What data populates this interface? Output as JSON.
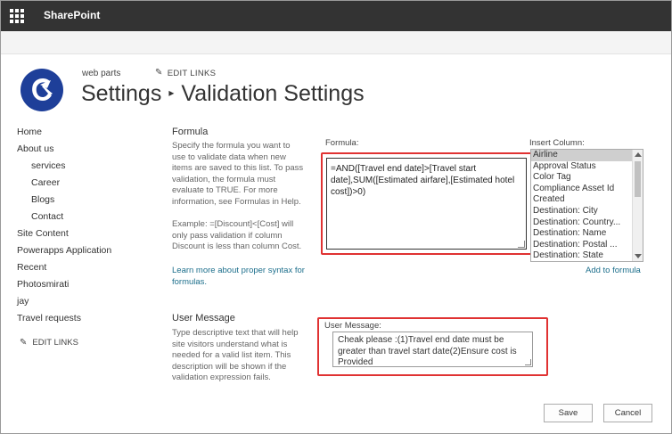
{
  "suite_bar": {
    "app_name": "SharePoint"
  },
  "header": {
    "site_name": "web parts",
    "edit_links": "EDIT LINKS",
    "title_parent": "Settings",
    "title_current": "Validation Settings",
    "title_separator": "▸"
  },
  "left_nav": {
    "items": [
      {
        "label": "Home",
        "indent": false
      },
      {
        "label": "About us",
        "indent": false
      },
      {
        "label": "services",
        "indent": true
      },
      {
        "label": "Career",
        "indent": true
      },
      {
        "label": "Blogs",
        "indent": true
      },
      {
        "label": "Contact",
        "indent": true
      },
      {
        "label": "Site Content",
        "indent": false
      },
      {
        "label": "Powerapps Application",
        "indent": false
      },
      {
        "label": "Recent",
        "indent": false
      },
      {
        "label": "Photosmirati",
        "indent": false
      },
      {
        "label": "jay",
        "indent": false
      },
      {
        "label": "Travel requests",
        "indent": false
      }
    ],
    "edit_links": "EDIT LINKS"
  },
  "formula_section": {
    "heading": "Formula",
    "description": "Specify the formula you want to use to validate data when new items are saved to this list. To pass validation, the formula must evaluate to TRUE. For more information, see Formulas in Help.",
    "example": "Example: =[Discount]<[Cost] will only pass validation if column Discount is less than column Cost.",
    "learn_more": "Learn more about proper syntax for formulas.",
    "field_label": "Formula:",
    "value": "=AND([Travel end date]>[Travel start date],SUM([Estimated airfare],[Estimated hotel cost])>0)"
  },
  "insert_column": {
    "label": "Insert Column:",
    "selected": "Airline",
    "options": [
      "Airline",
      "Approval Status",
      "Color Tag",
      "Compliance Asset Id",
      "Created",
      "Destination: City",
      "Destination: Country...",
      "Destination: Name",
      "Destination: Postal ...",
      "Destination: State"
    ],
    "add_link": "Add to formula"
  },
  "user_message_section": {
    "heading": "User Message",
    "description": "Type descriptive text that will help site visitors understand what is needed for a valid list item. This description will be shown if the validation expression fails.",
    "field_label": "User Message:",
    "value": "Cheak please :(1)Travel end date must be greater than travel start date(2)Ensure cost is Provided"
  },
  "actions": {
    "save": "Save",
    "cancel": "Cancel"
  },
  "colors": {
    "suite_bar": "#333333",
    "highlight_border": "#e03232",
    "link": "#1d6f8c",
    "logo": "#1e3f99"
  }
}
